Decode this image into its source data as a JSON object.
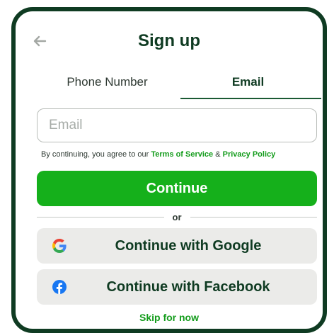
{
  "header": {
    "title": "Sign up"
  },
  "tabs": [
    {
      "label": "Phone Number"
    },
    {
      "label": "Email"
    }
  ],
  "email": {
    "placeholder": "Email",
    "value": ""
  },
  "terms": {
    "prefix": "By continuing, you agree to our ",
    "terms_link": "Terms of Service",
    "joiner": " & ",
    "privacy_link": "Privacy Policy"
  },
  "continue_label": "Continue",
  "divider_label": "or",
  "social": {
    "google_label": "Continue with Google",
    "facebook_label": "Continue with Facebook"
  },
  "skip_label": "Skip for now",
  "icons": {
    "back": "arrow-left-icon",
    "google": "google-icon",
    "facebook": "facebook-icon"
  },
  "colors": {
    "frame": "#0f3b22",
    "title": "#0f3b22",
    "primary_button": "#15b01b",
    "link": "#139c1b",
    "social_button_bg": "#ebebe9",
    "facebook_blue": "#1877f2"
  }
}
